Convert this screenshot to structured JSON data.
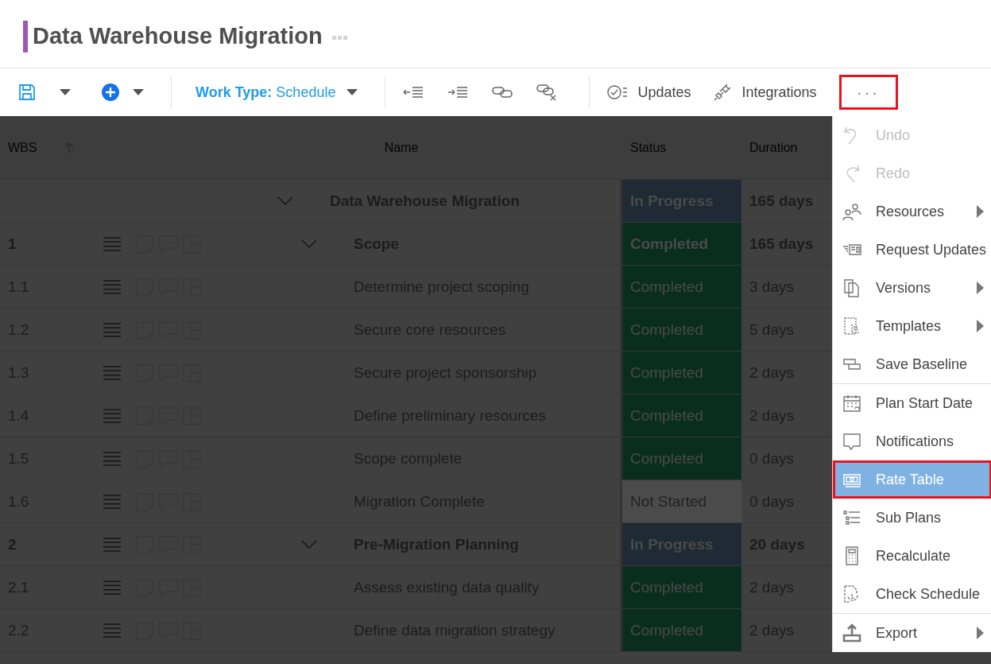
{
  "title": "Data Warehouse Migration",
  "toolbar": {
    "work_type": "**Work Type:** Schedule",
    "updates": "Updates",
    "integrations": "Integrations",
    "more": "···",
    "more_highlighted": true
  },
  "table": {
    "columns": [
      "WBS",
      "Name",
      "Status",
      "Duration"
    ],
    "rows": [
      {
        "wbs": "",
        "name": "Data Warehouse Migration",
        "status": "In Progress",
        "kind": "in_progress",
        "duration": "165 days",
        "expanded": true,
        "children": [
          {
            "wbs": "1",
            "name": "Scope",
            "status": "Completed",
            "kind": "completed",
            "duration": "165 days",
            "expanded": true,
            "children": [
              {
                "wbs": "1.1",
                "name": "Determine project scoping",
                "status": "Completed",
                "kind": "completed",
                "duration": "3 days"
              },
              {
                "wbs": "1.2",
                "name": "Secure core resources",
                "status": "Completed",
                "kind": "completed",
                "duration": "5 days"
              },
              {
                "wbs": "1.3",
                "name": "Secure project sponsorship",
                "status": "Completed",
                "kind": "completed",
                "duration": "2 days"
              },
              {
                "wbs": "1.4",
                "name": "Define preliminary resources",
                "status": "Completed",
                "kind": "completed",
                "duration": "2 days"
              },
              {
                "wbs": "1.5",
                "name": "Scope complete",
                "status": "Completed",
                "kind": "completed",
                "duration": "0 days"
              },
              {
                "wbs": "1.6",
                "name": "Migration Complete",
                "status": "Not Started",
                "kind": "not_started",
                "duration": "0 days"
              }
            ]
          },
          {
            "wbs": "2",
            "name": "Pre-Migration Planning",
            "status": "In Progress",
            "kind": "in_progress",
            "duration": "20 days",
            "expanded": true,
            "children": [
              {
                "wbs": "2.1",
                "name": "Assess existing data quality",
                "status": "Completed",
                "kind": "completed",
                "duration": "2 days"
              },
              {
                "wbs": "2.2",
                "name": "Define data migration strategy",
                "status": "Completed",
                "kind": "completed",
                "duration": "2 days"
              }
            ]
          }
        ]
      }
    ]
  },
  "menu": {
    "sections": [
      [
        {
          "label": "Undo",
          "kind": "undo",
          "disabled": true,
          "submenu": false,
          "selected": false
        },
        {
          "label": "Redo",
          "kind": "redo",
          "disabled": true,
          "submenu": false,
          "selected": false
        },
        {
          "label": "Resources",
          "kind": "people",
          "disabled": false,
          "submenu": true,
          "selected": false
        },
        {
          "label": "Request Updates",
          "kind": "request",
          "disabled": false,
          "submenu": false,
          "selected": false
        },
        {
          "label": "Versions",
          "kind": "pages",
          "disabled": false,
          "submenu": true,
          "selected": false
        },
        {
          "label": "Templates",
          "kind": "template",
          "disabled": false,
          "submenu": true,
          "selected": false
        },
        {
          "label": "Save Baseline",
          "kind": "baseline",
          "disabled": false,
          "submenu": false,
          "selected": false
        }
      ],
      [
        {
          "label": "Plan Start Date",
          "kind": "calendar",
          "disabled": false,
          "submenu": false,
          "selected": false
        },
        {
          "label": "Notifications",
          "kind": "bubble",
          "disabled": false,
          "submenu": false,
          "selected": false
        },
        {
          "label": "Rate Table",
          "kind": "money",
          "disabled": false,
          "submenu": false,
          "selected": true,
          "highlighted": true
        },
        {
          "label": "Sub Plans",
          "kind": "list",
          "disabled": false,
          "submenu": false,
          "selected": false
        },
        {
          "label": "Recalculate",
          "kind": "calculator",
          "disabled": false,
          "submenu": false,
          "selected": false
        },
        {
          "label": "Check Schedule",
          "kind": "check-doc",
          "disabled": false,
          "submenu": false,
          "selected": false
        }
      ],
      [
        {
          "label": "Export",
          "kind": "export",
          "disabled": false,
          "submenu": true,
          "selected": false
        }
      ]
    ]
  }
}
